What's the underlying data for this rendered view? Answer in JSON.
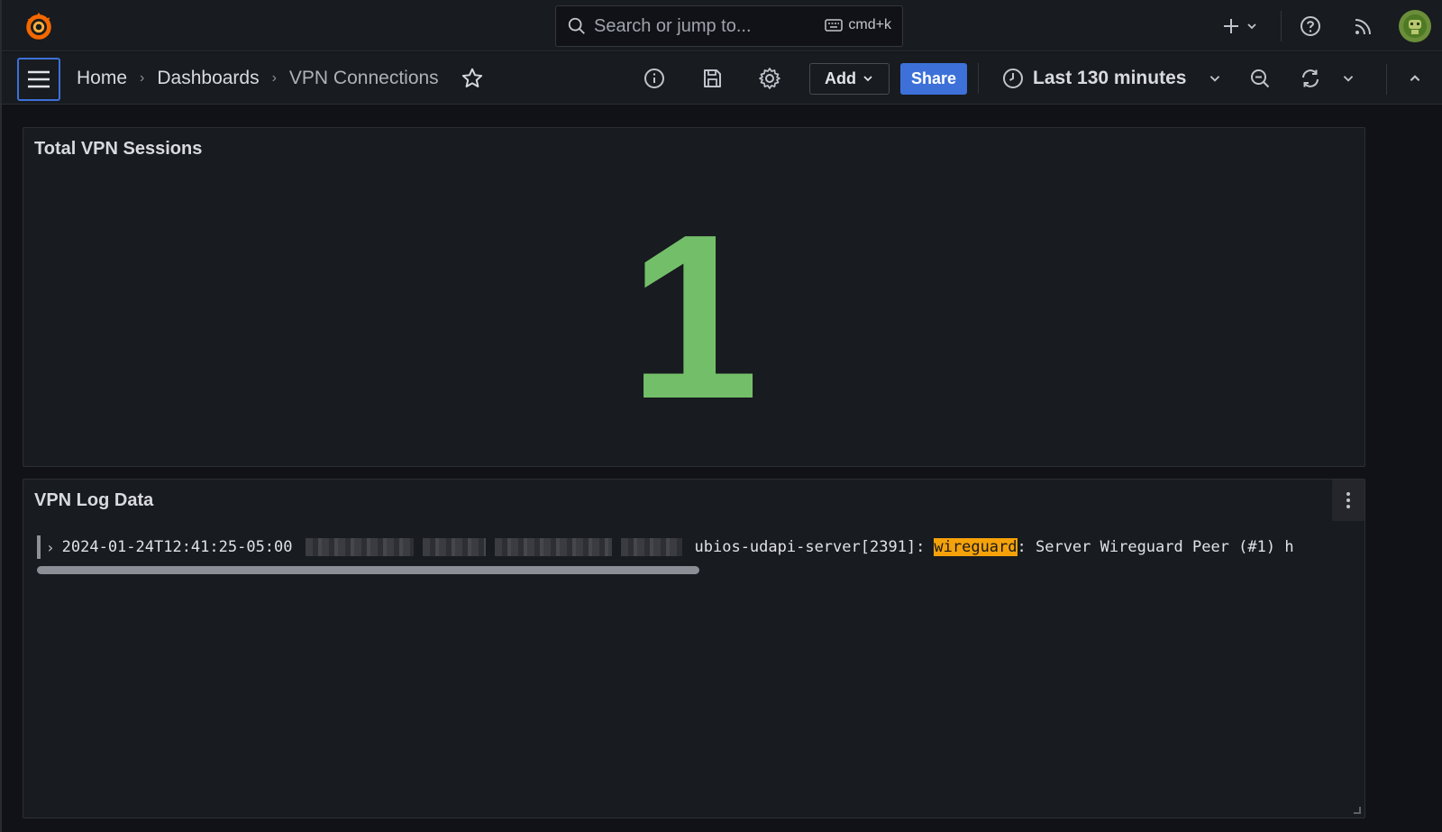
{
  "topbar": {
    "logo": "grafana-logo",
    "search": {
      "placeholder": "Search or jump to...",
      "shortcut": "cmd+k"
    },
    "icons": [
      "plus-icon",
      "chevron-down-icon",
      "help-icon",
      "rss-icon",
      "avatar"
    ]
  },
  "nav": {
    "breadcrumbs": [
      {
        "label": "Home"
      },
      {
        "label": "Dashboards"
      },
      {
        "label": "VPN Connections"
      }
    ],
    "add_label": "Add",
    "share_label": "Share",
    "time_range": "Last 130 minutes"
  },
  "panels": {
    "stat": {
      "title": "Total VPN Sessions",
      "value": "1",
      "color": "#73bf69"
    },
    "logs": {
      "title": "VPN Log Data",
      "row": {
        "timestamp": "2024-01-24T12:41:25-05:00",
        "source": "ubios-udapi-server[2391]:",
        "highlight": "wireguard",
        "message": ": Server Wireguard Peer (#1) h"
      }
    }
  },
  "colors": {
    "accent": "#3d71d9",
    "highlight": "#f5a20a"
  }
}
